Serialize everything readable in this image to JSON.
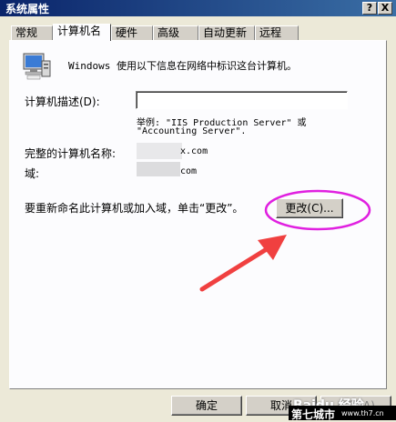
{
  "window": {
    "title": "系统属性",
    "help_glyph": "?",
    "close_glyph": "X"
  },
  "tabs": [
    {
      "label": "常规"
    },
    {
      "label": "计算机名"
    },
    {
      "label": "硬件"
    },
    {
      "label": "高级"
    },
    {
      "label": "自动更新"
    },
    {
      "label": "远程"
    }
  ],
  "info_text": "Windows 使用以下信息在网络中标识这台计算机。",
  "description": {
    "label": "计算机描述(D):",
    "value": "",
    "example_line1": "举例: \"IIS Production Server\" 或",
    "example_line2": "\"Accounting Server\"."
  },
  "full_name": {
    "label": "完整的计算机名称:",
    "value_suffix": "x.com"
  },
  "domain": {
    "label": "域:",
    "value_suffix": "com"
  },
  "rename_text": "要重新命名此计算机或加入域，单击“更改”。",
  "change_button": "更改(C)...",
  "footer": {
    "ok": "确定",
    "cancel": "取消",
    "apply": "应用(A)"
  },
  "watermark": {
    "baidu": "Baidu 经验",
    "site": "第七城市",
    "url": "www.th7.cn"
  },
  "colors": {
    "highlight_circle": "#e020e0",
    "arrow": "#f04040",
    "titlebar": "#0a246a"
  }
}
